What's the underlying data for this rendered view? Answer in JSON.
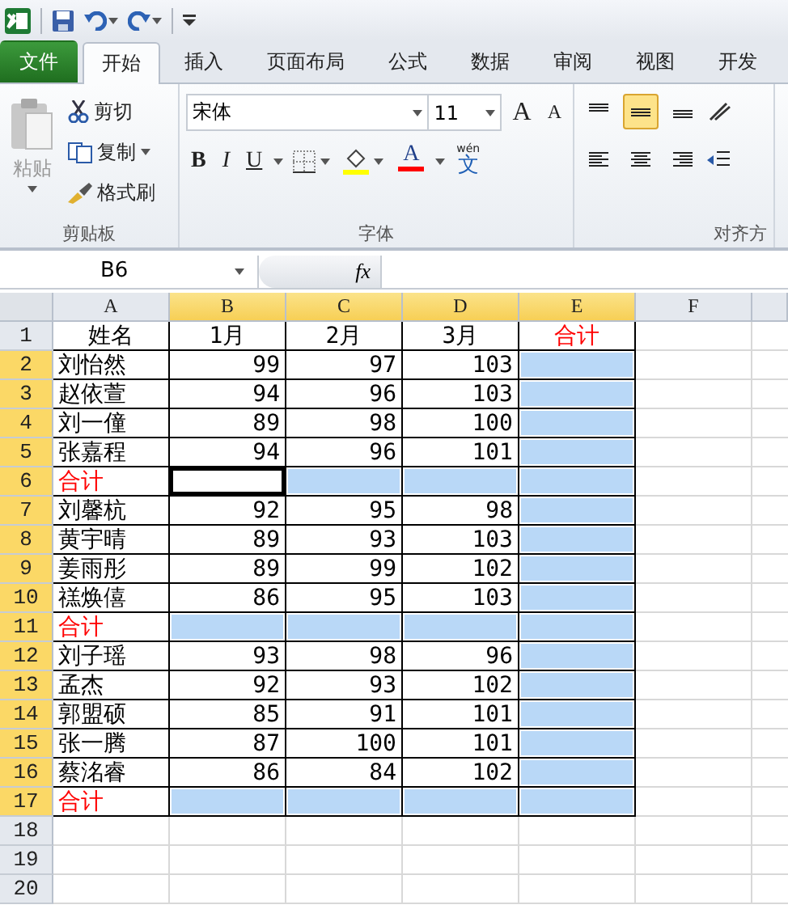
{
  "tabs": [
    {
      "label": "文件",
      "kind": "file",
      "selected": false
    },
    {
      "label": "开始",
      "kind": "tab",
      "selected": true
    },
    {
      "label": "插入",
      "kind": "tab",
      "selected": false
    },
    {
      "label": "页面布局",
      "kind": "tab",
      "selected": false
    },
    {
      "label": "公式",
      "kind": "tab",
      "selected": false
    },
    {
      "label": "数据",
      "kind": "tab",
      "selected": false
    },
    {
      "label": "审阅",
      "kind": "tab",
      "selected": false
    },
    {
      "label": "视图",
      "kind": "tab",
      "selected": false
    },
    {
      "label": "开发",
      "kind": "tab",
      "selected": false
    }
  ],
  "clipboard": {
    "paste": {
      "label": "粘贴",
      "disabled": true
    },
    "cut": "剪切",
    "copy": "复制",
    "format_painter": "格式刷",
    "group_label": "剪贴板"
  },
  "font": {
    "name": "宋体",
    "size": "11",
    "grow_letter": "A",
    "shrink_letter": "A",
    "bold": "B",
    "italic": "I",
    "underline": "U",
    "font_color_letter": "A",
    "phonetic": "文",
    "phonetic_top": "wén",
    "group_label": "字体"
  },
  "alignment": {
    "vertical": [
      {
        "selected": false
      },
      {
        "selected": true
      },
      {
        "selected": false
      }
    ],
    "group_label": "对齐方"
  },
  "name_box": "B6",
  "fx": "fx",
  "columns": [
    {
      "label": "A",
      "selected": false
    },
    {
      "label": "B",
      "selected": true
    },
    {
      "label": "C",
      "selected": true
    },
    {
      "label": "D",
      "selected": true
    },
    {
      "label": "E",
      "selected": true
    },
    {
      "label": "F",
      "selected": false
    }
  ],
  "rows": [
    {
      "label": "1",
      "selected": false,
      "cells": [
        {
          "text": "姓名",
          "kind": "header",
          "selected": false
        },
        {
          "text": "1月",
          "kind": "header",
          "selected": false
        },
        {
          "text": "2月",
          "kind": "header",
          "selected": false
        },
        {
          "text": "3月",
          "kind": "header",
          "selected": false
        },
        {
          "text": "合计",
          "kind": "header",
          "color": "#ff0000",
          "selected": false
        },
        {
          "selected": false
        }
      ]
    },
    {
      "label": "2",
      "selected": true,
      "cells": [
        {
          "text": "刘怡然",
          "kind": "name",
          "selected": false
        },
        {
          "text": "99",
          "kind": "number",
          "selected": false
        },
        {
          "text": "97",
          "kind": "number",
          "selected": false
        },
        {
          "text": "103",
          "kind": "number",
          "selected": false
        },
        {
          "kind": "blank",
          "selected": true
        },
        {
          "selected": false
        }
      ]
    },
    {
      "label": "3",
      "selected": true,
      "cells": [
        {
          "text": "赵依萱",
          "kind": "name",
          "selected": false
        },
        {
          "text": "94",
          "kind": "number",
          "selected": false
        },
        {
          "text": "96",
          "kind": "number",
          "selected": false
        },
        {
          "text": "103",
          "kind": "number",
          "selected": false
        },
        {
          "kind": "blank",
          "selected": true
        },
        {
          "selected": false
        }
      ]
    },
    {
      "label": "4",
      "selected": true,
      "cells": [
        {
          "text": "刘一僮",
          "kind": "name",
          "selected": false
        },
        {
          "text": "89",
          "kind": "number",
          "selected": false
        },
        {
          "text": "98",
          "kind": "number",
          "selected": false
        },
        {
          "text": "100",
          "kind": "number",
          "selected": false
        },
        {
          "kind": "blank",
          "selected": true
        },
        {
          "selected": false
        }
      ]
    },
    {
      "label": "5",
      "selected": true,
      "cells": [
        {
          "text": "张嘉程",
          "kind": "name",
          "selected": false
        },
        {
          "text": "94",
          "kind": "number",
          "selected": false
        },
        {
          "text": "96",
          "kind": "number",
          "selected": false
        },
        {
          "text": "101",
          "kind": "number",
          "selected": false
        },
        {
          "kind": "blank",
          "selected": true
        },
        {
          "selected": false
        }
      ]
    },
    {
      "label": "6",
      "selected": true,
      "cells": [
        {
          "text": "合计",
          "kind": "name",
          "color": "#ff0000",
          "selected": false
        },
        {
          "kind": "blank",
          "selected": true,
          "active": true
        },
        {
          "kind": "blank",
          "selected": true
        },
        {
          "kind": "blank",
          "selected": true
        },
        {
          "kind": "blank",
          "selected": true
        },
        {
          "selected": false
        }
      ]
    },
    {
      "label": "7",
      "selected": true,
      "cells": [
        {
          "text": "刘馨杭",
          "kind": "name",
          "selected": false
        },
        {
          "text": "92",
          "kind": "number",
          "selected": false
        },
        {
          "text": "95",
          "kind": "number",
          "selected": false
        },
        {
          "text": "98",
          "kind": "number",
          "selected": false
        },
        {
          "kind": "blank",
          "selected": true
        },
        {
          "selected": false
        }
      ]
    },
    {
      "label": "8",
      "selected": true,
      "cells": [
        {
          "text": "黄宇晴",
          "kind": "name",
          "selected": false
        },
        {
          "text": "89",
          "kind": "number",
          "selected": false
        },
        {
          "text": "93",
          "kind": "number",
          "selected": false
        },
        {
          "text": "103",
          "kind": "number",
          "selected": false
        },
        {
          "kind": "blank",
          "selected": true
        },
        {
          "selected": false
        }
      ]
    },
    {
      "label": "9",
      "selected": true,
      "cells": [
        {
          "text": "姜雨彤",
          "kind": "name",
          "selected": false
        },
        {
          "text": "89",
          "kind": "number",
          "selected": false
        },
        {
          "text": "99",
          "kind": "number",
          "selected": false
        },
        {
          "text": "102",
          "kind": "number",
          "selected": false
        },
        {
          "kind": "blank",
          "selected": true
        },
        {
          "selected": false
        }
      ]
    },
    {
      "label": "10",
      "selected": true,
      "cells": [
        {
          "text": "禚焕僖",
          "kind": "name",
          "selected": false
        },
        {
          "text": "86",
          "kind": "number",
          "selected": false
        },
        {
          "text": "95",
          "kind": "number",
          "selected": false
        },
        {
          "text": "103",
          "kind": "number",
          "selected": false
        },
        {
          "kind": "blank",
          "selected": true
        },
        {
          "selected": false
        }
      ]
    },
    {
      "label": "11",
      "selected": true,
      "cells": [
        {
          "text": "合计",
          "kind": "name",
          "color": "#ff0000",
          "selected": false
        },
        {
          "kind": "blank",
          "selected": true
        },
        {
          "kind": "blank",
          "selected": true
        },
        {
          "kind": "blank",
          "selected": true
        },
        {
          "kind": "blank",
          "selected": true
        },
        {
          "selected": false
        }
      ]
    },
    {
      "label": "12",
      "selected": true,
      "cells": [
        {
          "text": "刘子瑶",
          "kind": "name",
          "selected": false
        },
        {
          "text": "93",
          "kind": "number",
          "selected": false
        },
        {
          "text": "98",
          "kind": "number",
          "selected": false
        },
        {
          "text": "96",
          "kind": "number",
          "selected": false
        },
        {
          "kind": "blank",
          "selected": true
        },
        {
          "selected": false
        }
      ]
    },
    {
      "label": "13",
      "selected": true,
      "cells": [
        {
          "text": "孟杰",
          "kind": "name",
          "selected": false
        },
        {
          "text": "92",
          "kind": "number",
          "selected": false
        },
        {
          "text": "93",
          "kind": "number",
          "selected": false
        },
        {
          "text": "102",
          "kind": "number",
          "selected": false
        },
        {
          "kind": "blank",
          "selected": true
        },
        {
          "selected": false
        }
      ]
    },
    {
      "label": "14",
      "selected": true,
      "cells": [
        {
          "text": "郭盟硕",
          "kind": "name",
          "selected": false
        },
        {
          "text": "85",
          "kind": "number",
          "selected": false
        },
        {
          "text": "91",
          "kind": "number",
          "selected": false
        },
        {
          "text": "101",
          "kind": "number",
          "selected": false
        },
        {
          "kind": "blank",
          "selected": true
        },
        {
          "selected": false
        }
      ]
    },
    {
      "label": "15",
      "selected": true,
      "cells": [
        {
          "text": "张一腾",
          "kind": "name",
          "selected": false
        },
        {
          "text": "87",
          "kind": "number",
          "selected": false
        },
        {
          "text": "100",
          "kind": "number",
          "selected": false
        },
        {
          "text": "101",
          "kind": "number",
          "selected": false
        },
        {
          "kind": "blank",
          "selected": true
        },
        {
          "selected": false
        }
      ]
    },
    {
      "label": "16",
      "selected": true,
      "cells": [
        {
          "text": "蔡洺睿",
          "kind": "name",
          "selected": false
        },
        {
          "text": "86",
          "kind": "number",
          "selected": false
        },
        {
          "text": "84",
          "kind": "number",
          "selected": false
        },
        {
          "text": "102",
          "kind": "number",
          "selected": false
        },
        {
          "kind": "blank",
          "selected": true
        },
        {
          "selected": false
        }
      ]
    },
    {
      "label": "17",
      "selected": true,
      "cells": [
        {
          "text": "合计",
          "kind": "name",
          "color": "#ff0000",
          "selected": false
        },
        {
          "kind": "blank",
          "selected": true
        },
        {
          "kind": "blank",
          "selected": true
        },
        {
          "kind": "blank",
          "selected": true
        },
        {
          "kind": "blank",
          "selected": true
        },
        {
          "selected": false
        }
      ]
    },
    {
      "label": "18",
      "selected": false,
      "cells": [
        {
          "selected": false
        },
        {
          "selected": false
        },
        {
          "selected": false
        },
        {
          "selected": false
        },
        {
          "selected": false
        },
        {
          "selected": false
        }
      ]
    },
    {
      "label": "19",
      "selected": false,
      "cells": [
        {
          "selected": false
        },
        {
          "selected": false
        },
        {
          "selected": false
        },
        {
          "selected": false
        },
        {
          "selected": false
        },
        {
          "selected": false
        }
      ]
    },
    {
      "label": "20",
      "selected": false,
      "cells": [
        {
          "selected": false
        },
        {
          "selected": false
        },
        {
          "selected": false
        },
        {
          "selected": false
        },
        {
          "selected": false
        },
        {
          "selected": false
        }
      ]
    }
  ]
}
